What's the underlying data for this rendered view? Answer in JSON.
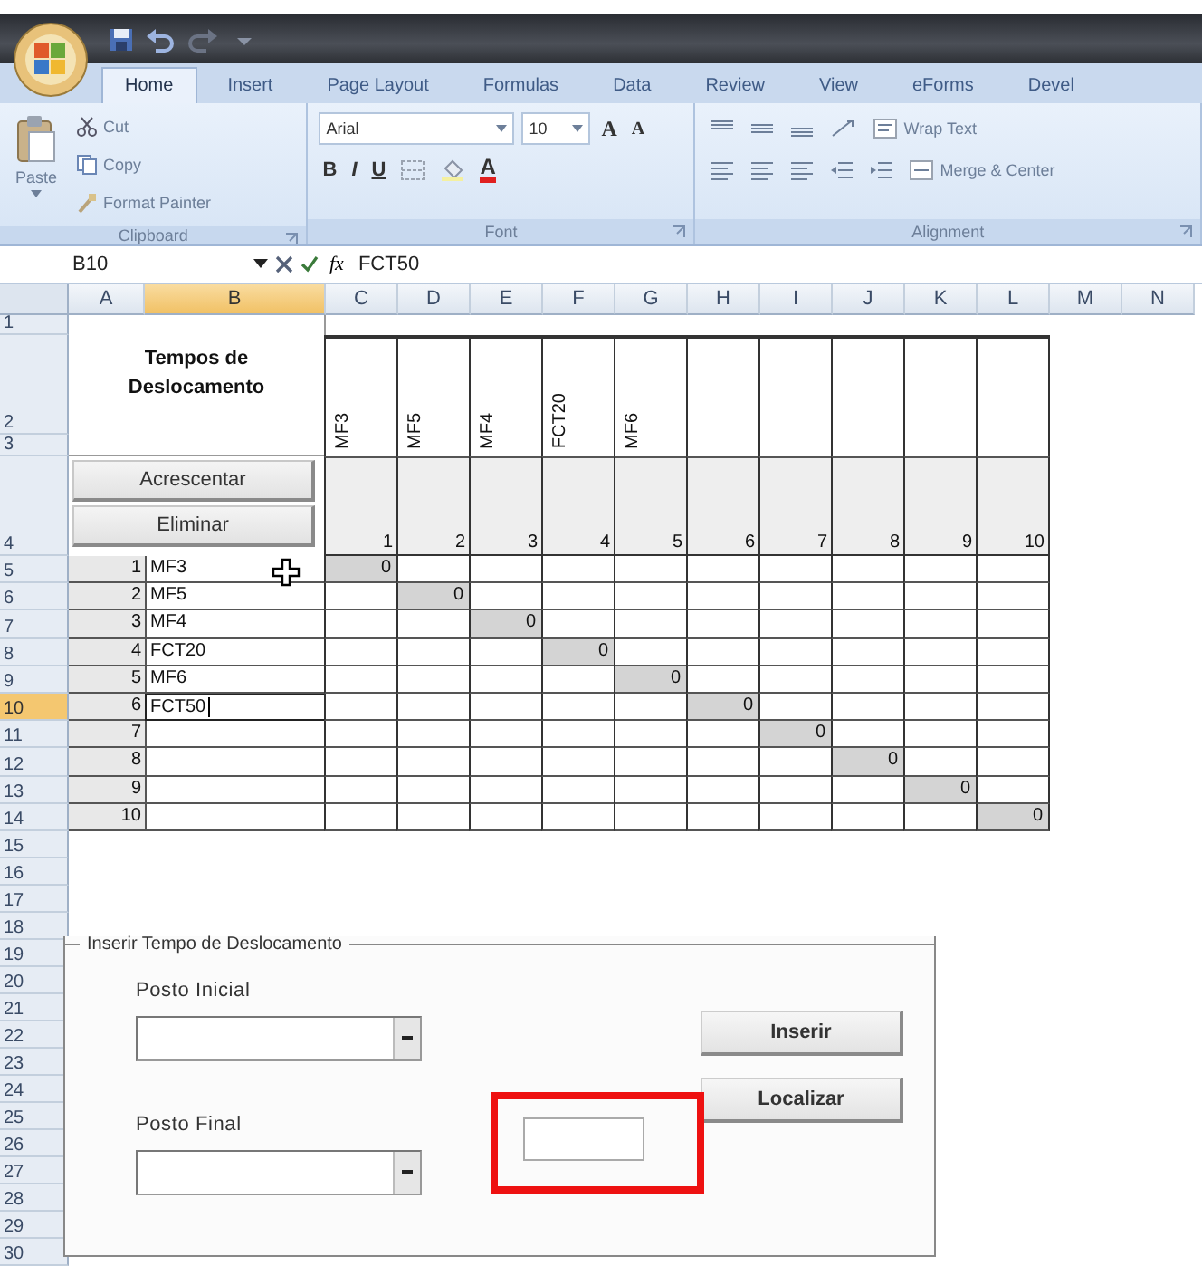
{
  "tabs": [
    {
      "label": "Home",
      "selected": true
    },
    {
      "label": "Insert",
      "selected": false
    },
    {
      "label": "Page Layout",
      "selected": false
    },
    {
      "label": "Formulas",
      "selected": false
    },
    {
      "label": "Data",
      "selected": false
    },
    {
      "label": "Review",
      "selected": false
    },
    {
      "label": "View",
      "selected": false
    },
    {
      "label": "eForms",
      "selected": false
    },
    {
      "label": "Devel",
      "selected": false
    }
  ],
  "ribbon": {
    "clipboard": {
      "label": "Clipboard",
      "paste": "Paste",
      "cut": "Cut",
      "copy": "Copy",
      "format_painter": "Format Painter"
    },
    "font": {
      "label": "Font",
      "font_name": "Arial",
      "font_size": "10",
      "grow": "A",
      "shrink": "A",
      "bold": "B",
      "italic": "I",
      "underline": "U",
      "font_color": "A"
    },
    "alignment": {
      "label": "Alignment",
      "wrap_text": "Wrap Text",
      "merge_center": "Merge & Center"
    }
  },
  "formula_bar": {
    "name_box": "B10",
    "fx": "fx",
    "value": "FCT50"
  },
  "sheet": {
    "columns": [
      {
        "label": "A",
        "selected": false
      },
      {
        "label": "B",
        "selected": true
      },
      {
        "label": "C",
        "selected": false
      },
      {
        "label": "D",
        "selected": false
      },
      {
        "label": "E",
        "selected": false
      },
      {
        "label": "F",
        "selected": false
      },
      {
        "label": "G",
        "selected": false
      },
      {
        "label": "H",
        "selected": false
      },
      {
        "label": "I",
        "selected": false
      },
      {
        "label": "J",
        "selected": false
      },
      {
        "label": "K",
        "selected": false
      },
      {
        "label": "L",
        "selected": false
      },
      {
        "label": "M",
        "selected": false
      },
      {
        "label": "N",
        "selected": false
      }
    ],
    "rows": [
      {
        "label": "1",
        "selected": false
      },
      {
        "label": "2",
        "selected": false
      },
      {
        "label": "3",
        "selected": false
      },
      {
        "label": "4",
        "selected": false
      },
      {
        "label": "5",
        "selected": false
      },
      {
        "label": "6",
        "selected": false
      },
      {
        "label": "7",
        "selected": false
      },
      {
        "label": "8",
        "selected": false
      },
      {
        "label": "9",
        "selected": false
      },
      {
        "label": "10",
        "selected": true
      },
      {
        "label": "11",
        "selected": false
      },
      {
        "label": "12",
        "selected": false
      },
      {
        "label": "13",
        "selected": false
      },
      {
        "label": "14",
        "selected": false
      },
      {
        "label": "15",
        "selected": false
      },
      {
        "label": "16",
        "selected": false
      },
      {
        "label": "17",
        "selected": false
      },
      {
        "label": "18",
        "selected": false
      },
      {
        "label": "19",
        "selected": false
      },
      {
        "label": "20",
        "selected": false
      },
      {
        "label": "21",
        "selected": false
      },
      {
        "label": "22",
        "selected": false
      },
      {
        "label": "23",
        "selected": false
      },
      {
        "label": "24",
        "selected": false
      },
      {
        "label": "25",
        "selected": false
      },
      {
        "label": "26",
        "selected": false
      },
      {
        "label": "27",
        "selected": false
      },
      {
        "label": "28",
        "selected": false
      },
      {
        "label": "29",
        "selected": false
      },
      {
        "label": "30",
        "selected": false
      }
    ],
    "title": "Tempos de Deslocamento",
    "buttons": [
      "Acrescentar",
      "Eliminar"
    ],
    "matrix_columns": [
      {
        "number": "1",
        "name": "MF3"
      },
      {
        "number": "2",
        "name": "MF5"
      },
      {
        "number": "3",
        "name": "MF4"
      },
      {
        "number": "4",
        "name": "FCT20"
      },
      {
        "number": "5",
        "name": "MF6"
      },
      {
        "number": "6"
      },
      {
        "number": "7"
      },
      {
        "number": "8"
      },
      {
        "number": "9"
      },
      {
        "number": "10"
      }
    ],
    "stations": [
      {
        "number": "1",
        "name": "MF3",
        "diagonal": "0",
        "editing": false
      },
      {
        "number": "2",
        "name": "MF5",
        "diagonal": "0",
        "editing": false
      },
      {
        "number": "3",
        "name": "MF4",
        "diagonal": "0",
        "editing": false
      },
      {
        "number": "4",
        "name": "FCT20",
        "diagonal": "0",
        "editing": false
      },
      {
        "number": "5",
        "name": "MF6",
        "diagonal": "0",
        "editing": false
      },
      {
        "number": "6",
        "name": "FCT50",
        "diagonal": "0",
        "editing": true
      },
      {
        "number": "7",
        "diagonal": "0",
        "editing": false
      },
      {
        "number": "8",
        "diagonal": "0",
        "editing": false
      },
      {
        "number": "9",
        "diagonal": "0",
        "editing": false
      },
      {
        "number": "10",
        "diagonal": "0",
        "editing": false
      }
    ]
  },
  "form": {
    "title": "Inserir Tempo de Deslocamento",
    "fields": [
      {
        "label": "Posto Inicial"
      },
      {
        "label": "Posto Final"
      }
    ],
    "buttons": [
      "Inserir",
      "Localizar"
    ],
    "time_box": {
      "highlighted": true
    }
  }
}
